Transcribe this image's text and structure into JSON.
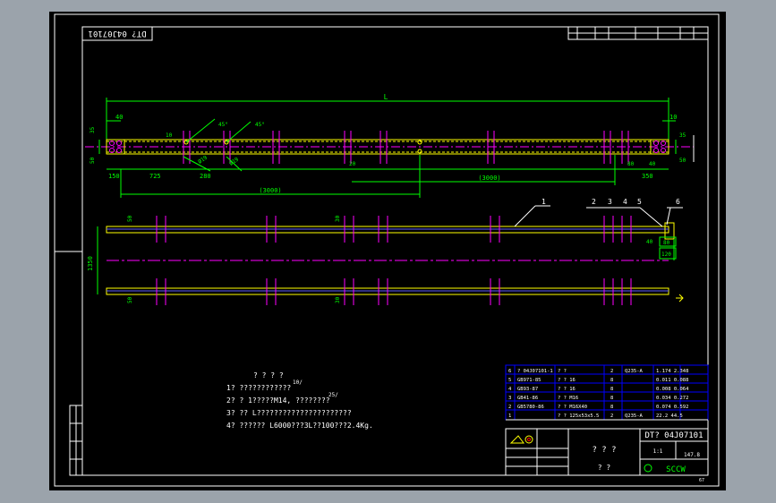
{
  "colors": {
    "background": "#9ba3ab",
    "sheet": "#000000",
    "frame": "#ffffff",
    "outline": "#ffff00",
    "dimension": "#00ff00",
    "centerline": "#ff00ff",
    "hatch": "#5c5cff",
    "text": "#ffffff"
  },
  "drawing": {
    "rotated_code": "DT? 04J07101",
    "top_view": {
      "overall_length": "L",
      "left_end_offset": "40",
      "right_end_offset": "10",
      "left_height_top": "35",
      "left_height_bottom": "50",
      "right_height_top": "35",
      "right_height_bottom": "50",
      "angle_1": "45°",
      "angle_2": "45°",
      "small_10": "10",
      "hole_dia_left": "Ø19",
      "hole_dia_right": "Ø19",
      "dim_150": "150",
      "dim_725": "725",
      "dim_280": "280",
      "dim_20": "20",
      "dim_80": "80",
      "dim_40": "40",
      "dim_350": "350",
      "span_left": "(3000)",
      "span_right": "(3000)"
    },
    "front_view": {
      "height": "1350",
      "top_mark": "50",
      "bottom_mark": "50",
      "mid_mark_top": "30",
      "mid_mark_bottom": "30",
      "dim_80": "80",
      "dim_40": "40",
      "dim_120": "120"
    },
    "callouts": [
      "1",
      "2",
      "3",
      "4",
      "5",
      "6"
    ]
  },
  "notes": {
    "title": "? ? ? ?",
    "lines": [
      "1? ????????????",
      "2? ? 1?????M14, ????????",
      "3? ?? L??????????????????????",
      "4? ?????? L6000???3L??100???2.4Kg."
    ],
    "weld_mark": "10/",
    "weld_mark_2": "25/"
  },
  "bom": {
    "rows": [
      {
        "no": "6",
        "code": "? 04J07101-1",
        "name": "? ?",
        "qty": "2",
        "material": "Q235-A",
        "weight": "1.174  2.348"
      },
      {
        "no": "5",
        "code": "GB971-85",
        "name": "? ? 16",
        "qty": "8",
        "material": "",
        "weight": "0.011  0.088"
      },
      {
        "no": "4",
        "code": "GB93-87",
        "name": "? ? 16",
        "qty": "8",
        "material": "",
        "weight": "0.008  0.064"
      },
      {
        "no": "3",
        "code": "GB41-86",
        "name": "? ? M16",
        "qty": "8",
        "material": "",
        "weight": "0.034  0.272"
      },
      {
        "no": "2",
        "code": "GB5780-86",
        "name": "? ? M16X40",
        "qty": "8",
        "material": "",
        "weight": "0.074  0.592"
      },
      {
        "no": "1",
        "code": "",
        "name": "? ? 125x53x5.5",
        "qty": "2",
        "material": "Q235-A",
        "weight": "22.2  44.5"
      }
    ]
  },
  "title_block": {
    "drawing_no": "DT? 04J07101",
    "name": "? ? ?",
    "sub_name": "? ?",
    "scale": "1:1",
    "weight": "147.8",
    "company": "SCCW",
    "sheet_ref": "67"
  }
}
